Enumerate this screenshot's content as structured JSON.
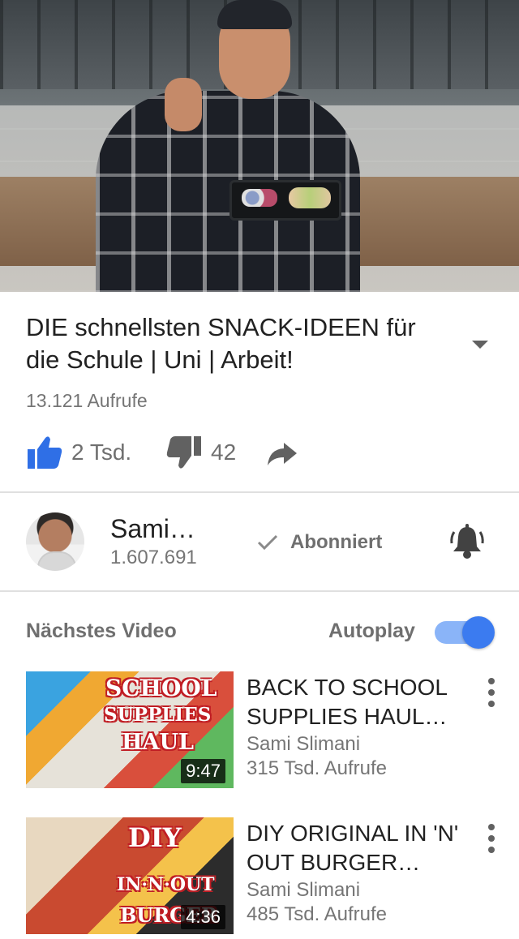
{
  "video": {
    "title": "DIE schnellsten SNACK-IDEEN für die Schule | Uni | Arbeit!",
    "views": "13.121 Aufrufe",
    "likes": "2 Tsd.",
    "dislikes": "42"
  },
  "channel": {
    "name": "Sami…",
    "subscribers": "1.607.691",
    "subscribed_label": "Abonniert"
  },
  "up_next": {
    "label": "Nächstes Video",
    "autoplay_label": "Autoplay",
    "autoplay_on": true
  },
  "related": [
    {
      "title": "BACK TO SCHOOL SUPPLIES HAUL…",
      "channel": "Sami Slimani",
      "views": "315 Tsd. Aufrufe",
      "duration": "9:47",
      "thumb_text": [
        "SCHOOL",
        "SUPPLIES",
        "HAUL"
      ]
    },
    {
      "title": "DIY ORIGINAL IN 'N' OUT BURGER…",
      "channel": "Sami Slimani",
      "views": "485 Tsd. Aufrufe",
      "duration": "4:36",
      "thumb_text": [
        "DIY",
        "IN·N·OUT",
        "BURGER"
      ]
    }
  ],
  "colors": {
    "accent_blue": "#2f6fe6",
    "toggle_track": "#8ab4f8",
    "text_secondary": "#757575"
  }
}
